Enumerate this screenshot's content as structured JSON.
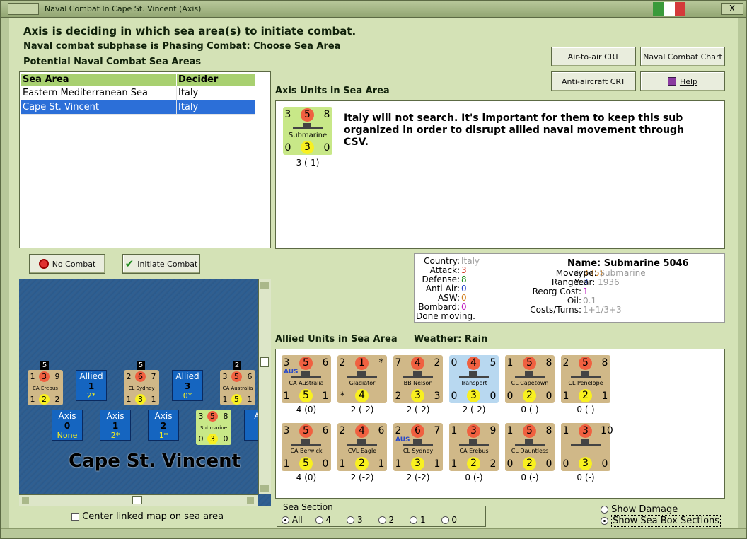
{
  "window": {
    "title": "Naval Combat In Cape St. Vincent (Axis)",
    "close_label": "X"
  },
  "colors": {
    "accent": "#2c6fd8",
    "header_green": "#a8d070",
    "attack": "#f06040",
    "defense": "#f8f020"
  },
  "header": {
    "line1": "Axis is deciding in which sea area(s) to initiate combat.",
    "line2": "Naval combat subphase is Phasing Combat: Choose Sea Area",
    "line3": "Potential Naval Combat Sea Areas"
  },
  "buttons": {
    "air_to_air": "Air-to-air CRT",
    "naval_chart": "Naval Combat Chart",
    "anti_aircraft": "Anti-aircraft CRT",
    "help": "Help",
    "no_combat": "No Combat",
    "initiate_combat": "Initiate Combat"
  },
  "sea_table": {
    "headers": [
      "Sea Area",
      "Decider"
    ],
    "rows": [
      {
        "area": "Eastern Mediterranean Sea",
        "decider": "Italy"
      },
      {
        "area": "Cape St. Vincent",
        "decider": "Italy"
      }
    ]
  },
  "axis_units": {
    "title": "Axis Units in Sea Area",
    "note": "Italy will not search.  It's important for them to keep this sub organized in order to disrupt allied naval movement through CSV.",
    "counter": {
      "tl": "3",
      "att": "5",
      "tr": "8",
      "name": "Submarine",
      "bl": "0",
      "def": "3",
      "br": "0",
      "caption": "3 (-1)"
    }
  },
  "unit_info": {
    "country_label": "Country:",
    "country": "Italy",
    "attack_label": "Attack:",
    "attack": "3",
    "defense_label": "Defense:",
    "defense": "8",
    "antiair_label": "Anti-Air:",
    "antiair": "0",
    "asw_label": "ASW:",
    "asw": "0",
    "bombard_label": "Bombard:",
    "bombard": "0",
    "status": "Done moving.",
    "name_label": "Name:",
    "name": "Submarine 5046",
    "move_label": "Move:",
    "move": "3",
    "move_extra": "(5)",
    "type_label": "Type:",
    "type": "Submarine",
    "range_label": "Range:",
    "range": "3",
    "year_label": "Year:",
    "year": "1936",
    "reorg_label": "Reorg Cost:",
    "reorg": "1",
    "oil_label": "Oil:",
    "oil": "0.1",
    "costs_label": "Costs/Turns:",
    "costs": "1+1/3+3"
  },
  "allied": {
    "title": "Allied Units in Sea Area",
    "weather": "Weather:  Rain",
    "units": [
      {
        "tl": "3",
        "att": "5",
        "tr": "6",
        "name": "CA Australia",
        "aus": "AUS",
        "bl": "1",
        "def": "5",
        "br": "1",
        "cap": "4 (0)",
        "kind": "ship"
      },
      {
        "tl": "2",
        "att": "1",
        "tr": "*",
        "name": "Gladiator",
        "aus": "",
        "bl": "*",
        "def": "4",
        "br": "",
        "cap": "2 (-2)",
        "kind": "air"
      },
      {
        "tl": "7",
        "att": "4",
        "tr": "2",
        "name": "BB Nelson",
        "aus": "",
        "bl": "2",
        "def": "3",
        "br": "3",
        "cap": "2 (-2)",
        "kind": "ship"
      },
      {
        "tl": "0",
        "att": "4",
        "tr": "5",
        "name": "Transport",
        "aus": "",
        "bl": "0",
        "def": "3",
        "br": "0",
        "cap": "2 (-2)",
        "kind": "trans"
      },
      {
        "tl": "1",
        "att": "5",
        "tr": "8",
        "name": "CL Capetown",
        "aus": "",
        "bl": "0",
        "def": "2",
        "br": "0",
        "cap": "0 (-)",
        "kind": "ship"
      },
      {
        "tl": "2",
        "att": "5",
        "tr": "8",
        "name": "CL Penelope",
        "aus": "",
        "bl": "1",
        "def": "2",
        "br": "1",
        "cap": "0 (-)",
        "kind": "ship"
      },
      {
        "tl": "3",
        "att": "5",
        "tr": "6",
        "name": "CA Berwick",
        "aus": "",
        "bl": "1",
        "def": "5",
        "br": "0",
        "cap": "4 (0)",
        "kind": "ship"
      },
      {
        "tl": "2",
        "att": "4",
        "tr": "6",
        "name": "CVL Eagle",
        "aus": "",
        "bl": "1",
        "def": "2",
        "br": "1",
        "cap": "2 (-2)",
        "kind": "ship"
      },
      {
        "tl": "2",
        "att": "6",
        "tr": "7",
        "name": "CL Sydney",
        "aus": "AUS",
        "bl": "1",
        "def": "3",
        "br": "1",
        "cap": "2 (-2)",
        "kind": "ship"
      },
      {
        "tl": "1",
        "att": "3",
        "tr": "9",
        "name": "CA Erebus",
        "aus": "",
        "bl": "1",
        "def": "2",
        "br": "2",
        "cap": "0 (-)",
        "kind": "ship"
      },
      {
        "tl": "1",
        "att": "5",
        "tr": "8",
        "name": "CL Dauntless",
        "aus": "",
        "bl": "0",
        "def": "2",
        "br": "0",
        "cap": "0 (-)",
        "kind": "ship"
      },
      {
        "tl": "1",
        "att": "3",
        "tr": "10",
        "name": "",
        "aus": "",
        "bl": "0",
        "def": "3",
        "br": "0",
        "cap": "0 (-)",
        "kind": "stack"
      }
    ]
  },
  "map": {
    "sea_name": "Cape St. Vincent",
    "counters": [
      {
        "tl": "1",
        "att": "3",
        "tr": "9",
        "name": "CA Erebus",
        "bl": "1",
        "def": "2",
        "br": "2",
        "badge": "5"
      },
      {
        "tl": "2",
        "att": "6",
        "tr": "7",
        "name": "CL Sydney",
        "bl": "1",
        "def": "3",
        "br": "1",
        "badge": "5"
      },
      {
        "tl": "3",
        "att": "5",
        "tr": "6",
        "name": "CA Australia",
        "bl": "1",
        "def": "5",
        "br": "1",
        "badge": "2"
      },
      {
        "tl": "3",
        "att": "5",
        "tr": "8",
        "name": "Submarine",
        "bl": "0",
        "def": "3",
        "br": "0",
        "badge": ""
      }
    ],
    "boxes": [
      {
        "side": "Allied",
        "num": "1",
        "val": "2*"
      },
      {
        "side": "Allied",
        "num": "3",
        "val": "0*"
      },
      {
        "side": "Axis",
        "num": "0",
        "val": "None"
      },
      {
        "side": "Axis",
        "num": "1",
        "val": "2*"
      },
      {
        "side": "Axis",
        "num": "2",
        "val": "1*"
      },
      {
        "side": "Ax",
        "num": "",
        "val": ""
      }
    ],
    "center_label": "Center linked map on sea area"
  },
  "sea_section": {
    "title": "Sea Section",
    "options": [
      "All",
      "4",
      "3",
      "2",
      "1",
      "0"
    ]
  },
  "show": {
    "damage": "Show Damage",
    "sections": "Show Sea Box Sections"
  }
}
